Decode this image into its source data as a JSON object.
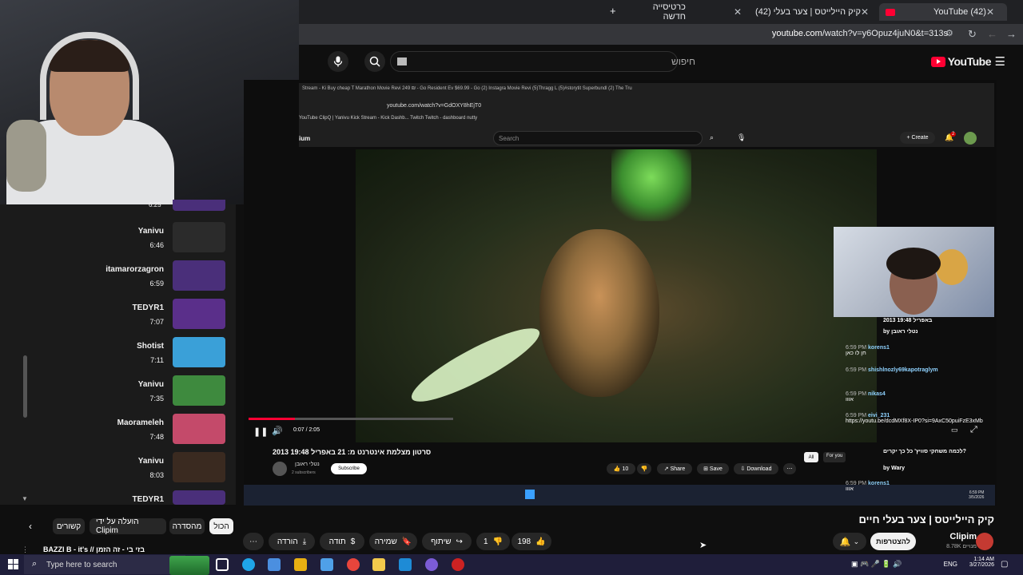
{
  "browser": {
    "tabs": [
      {
        "label": "(42) YouTube"
      },
      {
        "label": "קיק היילייטס | צער בעלי (42)"
      },
      {
        "label": "כרטיסייה חדשה"
      }
    ],
    "url_host": "youtube.com",
    "url_rest": "/watch?v=y6Opuz4juN0&t=313s"
  },
  "youtube": {
    "logo_text": "YouTube",
    "search_placeholder": "חיפוש"
  },
  "playlist": [
    {
      "name": "Yanivu",
      "time": "6:46"
    },
    {
      "name": "itamarorzagron",
      "time": "6:59"
    },
    {
      "name": "TEDYR1",
      "time": "7:07"
    },
    {
      "name": "Shotist",
      "time": "7:11"
    },
    {
      "name": "Yanivu",
      "time": "7:35"
    },
    {
      "name": "Maoramelеh",
      "time": "7:48"
    },
    {
      "name": "Yanivu",
      "time": "8:03"
    },
    {
      "name": "TEDYR1",
      "time": ""
    }
  ],
  "playlist_top_time": "6:25",
  "inner_browser": {
    "tabs": "Stream - Ki     Buy cheap T     Marathon     Movie Revi     249 ₪ - Go     Resident Ev     $69.99 - Go     (2) Instagra     Movie Revi     (5)Thragg L     (5)#storytit     Superbundl     (2) The Tru",
    "url": "youtube.com/watch?v=GdOXY8hEjT0",
    "bookmarks": "YouTube    ClipQ | Yanivu    Kick    Stream - Kick Dashb...    Twitch    Twitch - dashboard    nutty",
    "brand_partial": "ium",
    "search_placeholder": "Search",
    "create_label": "Create",
    "notif_count": "2",
    "video_time": "0:07 / 2:05",
    "video_title": "2013 סרטון מצלמת אינטרנט מ: 21 באפריל 19:48",
    "channel": "נטלי ראובן",
    "channel_subs": "2 subscribers",
    "subscribe": "Subscribe",
    "likes": "10",
    "share": "Share",
    "save": "Save",
    "download": "Download",
    "chip_all": "All",
    "chip_foryou": "For you"
  },
  "chat": [
    {
      "time": "",
      "user": "",
      "text": "2013 באפריל 19:48"
    },
    {
      "time": "",
      "user": "",
      "text": "by נטלי ראובן"
    },
    {
      "time": "6:59 PM",
      "user": "korens1",
      "text": "חן לו כאן"
    },
    {
      "time": "6:59 PM",
      "user": "shishlnozly69kapotraglym",
      "text": ""
    },
    {
      "time": "6:59 PM",
      "user": "nikas4",
      "text": "אווו"
    },
    {
      "time": "6:59 PM",
      "user": "eivi_231",
      "text": "https://youtu.be/dcdMXf8X-IP0?si=9AxC50puiFzE3xMb"
    },
    {
      "time": "",
      "user": "",
      "text": "לכמה משחקי סוויץ' כל כך יקרים?"
    },
    {
      "time": "",
      "user": "",
      "text": "by Wary"
    },
    {
      "time": "6:59 PM",
      "user": "korens1",
      "text": "אווו"
    }
  ],
  "chat_clock": "6:59 PM",
  "chat_date": "3/5/2026",
  "page": {
    "title": "קיק היילייטס | צער בעלי חיים",
    "channel_name": "Clipim",
    "channel_subs": "8.78K מנויים",
    "subscribe": "להצטרפות",
    "likes": "198",
    "dislikes": "1",
    "share": "שיתוף",
    "save": "שמירה",
    "thanks": "תודה",
    "download": "הורדה",
    "more": "⋯"
  },
  "chips": [
    {
      "label": "הכול",
      "selected": true
    },
    {
      "label": "מהסדרה",
      "selected": false
    },
    {
      "label": "הועלה על ידי Clipim",
      "selected": false
    },
    {
      "label": "קשורים",
      "selected": false
    }
  ],
  "next_video_title": "BAZZI B - it's // בזי בי - זה הזמן",
  "taskbar": {
    "search_placeholder": "Type here to search",
    "lang": "ENG",
    "clock": "1:14 AM",
    "date": "3/27/2026"
  },
  "colors": {
    "accent": "#ff0033",
    "background": "#0f0f0f",
    "taskbar": "#1f1e3a"
  }
}
